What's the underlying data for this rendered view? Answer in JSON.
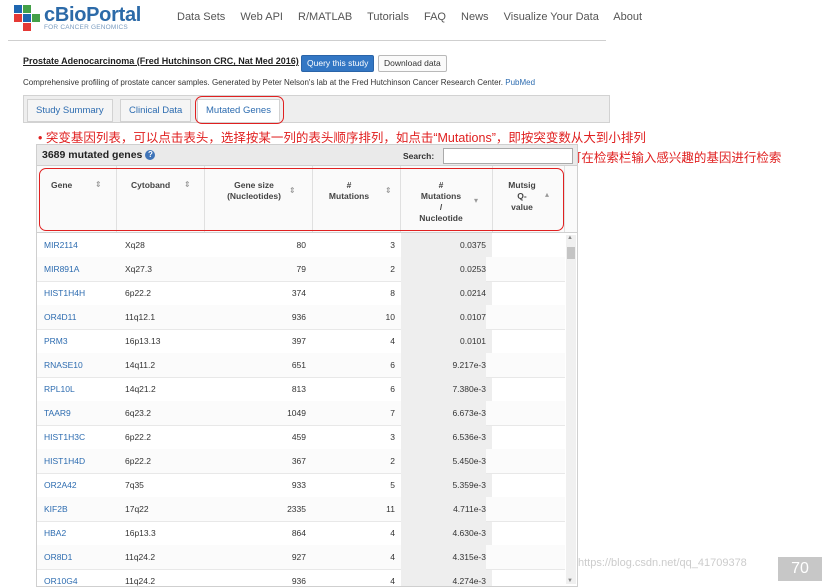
{
  "logo": {
    "name": "cBioPortal",
    "tagline": "FOR CANCER GENOMICS"
  },
  "nav": [
    "Data Sets",
    "Web API",
    "R/MATLAB",
    "Tutorials",
    "FAQ",
    "News",
    "Visualize Your Data",
    "About"
  ],
  "study": {
    "title": "Prostate Adenocarcinoma (Fred Hutchinson CRC, Nat Med 2016)",
    "query_btn": "Query this study",
    "download_btn": "Download data",
    "description": "Comprehensive profiling of prostate cancer samples. Generated by Peter Nelson's lab at the Fred Hutchinson Cancer Research Center.",
    "pubmed": "PubMed"
  },
  "tabs": [
    {
      "label": "Study Summary",
      "active": false
    },
    {
      "label": "Clinical Data",
      "active": false
    },
    {
      "label": "Mutated Genes",
      "active": true
    }
  ],
  "annotations": {
    "line1": "• 突变基因列表，可以点击表头，选择按某一列的表头顺序排列，如点击“Mutations”，即按突变数从大到小排列",
    "line2": "• 可在检索栏输入感兴趣的基因进行检索"
  },
  "panel": {
    "count": "3689 mutated genes",
    "help": "?",
    "search_label": "Search:",
    "search_value": ""
  },
  "columns": {
    "gene": "Gene",
    "cytoband": "Cytoband",
    "size1": "Gene size",
    "size2": "(Nucleotides)",
    "mut1": "#",
    "mut2": "Mutations",
    "pm1": "#",
    "pm2": "Mutations",
    "pm3": "/",
    "pm4": "Nucleotide",
    "q1": "Mutsig",
    "q2": "Q-",
    "q3": "value"
  },
  "rows": [
    {
      "gene": "MIR2114",
      "cytoband": "Xq28",
      "size": "80",
      "mutations": "3",
      "per_nt": "0.0375"
    },
    {
      "gene": "MIR891A",
      "cytoband": "Xq27.3",
      "size": "79",
      "mutations": "2",
      "per_nt": "0.0253"
    },
    {
      "gene": "HIST1H4H",
      "cytoband": "6p22.2",
      "size": "374",
      "mutations": "8",
      "per_nt": "0.0214"
    },
    {
      "gene": "OR4D11",
      "cytoband": "11q12.1",
      "size": "936",
      "mutations": "10",
      "per_nt": "0.0107"
    },
    {
      "gene": "PRM3",
      "cytoband": "16p13.13",
      "size": "397",
      "mutations": "4",
      "per_nt": "0.0101"
    },
    {
      "gene": "RNASE10",
      "cytoband": "14q11.2",
      "size": "651",
      "mutations": "6",
      "per_nt": "9.217e-3"
    },
    {
      "gene": "RPL10L",
      "cytoband": "14q21.2",
      "size": "813",
      "mutations": "6",
      "per_nt": "7.380e-3"
    },
    {
      "gene": "TAAR9",
      "cytoband": "6q23.2",
      "size": "1049",
      "mutations": "7",
      "per_nt": "6.673e-3"
    },
    {
      "gene": "HIST1H3C",
      "cytoband": "6p22.2",
      "size": "459",
      "mutations": "3",
      "per_nt": "6.536e-3"
    },
    {
      "gene": "HIST1H4D",
      "cytoband": "6p22.2",
      "size": "367",
      "mutations": "2",
      "per_nt": "5.450e-3"
    },
    {
      "gene": "OR2A42",
      "cytoband": "7q35",
      "size": "933",
      "mutations": "5",
      "per_nt": "5.359e-3"
    },
    {
      "gene": "KIF2B",
      "cytoband": "17q22",
      "size": "2335",
      "mutations": "11",
      "per_nt": "4.711e-3"
    },
    {
      "gene": "HBA2",
      "cytoband": "16p13.3",
      "size": "864",
      "mutations": "4",
      "per_nt": "4.630e-3"
    },
    {
      "gene": "OR8D1",
      "cytoband": "11q24.2",
      "size": "927",
      "mutations": "4",
      "per_nt": "4.315e-3"
    },
    {
      "gene": "OR10G4",
      "cytoband": "11q24.2",
      "size": "936",
      "mutations": "4",
      "per_nt": "4.274e-3"
    }
  ],
  "watermark": "https://blog.csdn.net/qq_41709378",
  "page_number": "70",
  "colors": {
    "brand": "#2c6aa8",
    "link": "#2d6cb0",
    "annotation": "#e02020",
    "query_button": "#3377c4"
  }
}
